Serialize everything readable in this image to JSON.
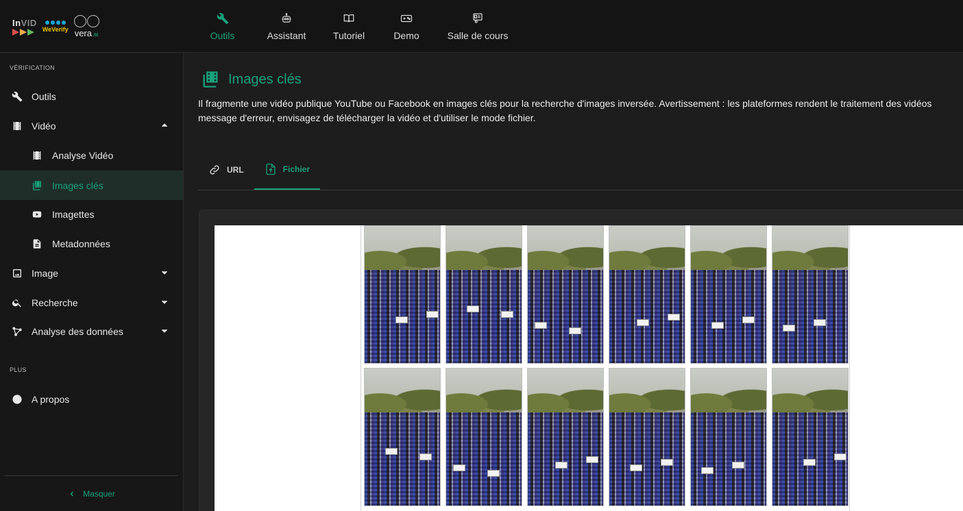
{
  "app": {
    "logos": {
      "invid_a": "In",
      "invid_b": "VID",
      "weverify": "WeVerify",
      "vera": "vera",
      "vera_sub": ".ai"
    }
  },
  "topnav": [
    {
      "label": "Outils",
      "icon": "wrench-icon",
      "active": true
    },
    {
      "label": "Assistant",
      "icon": "robot-icon",
      "active": false
    },
    {
      "label": "Tutoriel",
      "icon": "book-icon",
      "active": false
    },
    {
      "label": "Demo",
      "icon": "gamepad-icon",
      "active": false
    },
    {
      "label": "Salle de cours",
      "icon": "classroom-icon",
      "active": false
    }
  ],
  "sidebar": {
    "section_verification": "VÉRIFICATION",
    "section_plus": "PLUS",
    "items": [
      {
        "label": "Outils",
        "icon": "wrench-icon"
      },
      {
        "label": "Vidéo",
        "icon": "film-icon",
        "expanded": true
      },
      {
        "label": "Analyse Vidéo",
        "icon": "film-icon"
      },
      {
        "label": "Images clés",
        "icon": "keyframes-icon",
        "active": true
      },
      {
        "label": "Imagettes",
        "icon": "youtube-icon"
      },
      {
        "label": "Metadonnées",
        "icon": "document-icon"
      },
      {
        "label": "Image",
        "icon": "image-icon",
        "expanded": false
      },
      {
        "label": "Recherche",
        "icon": "search-icon",
        "expanded": false
      },
      {
        "label": "Analyse des données",
        "icon": "graph-icon",
        "expanded": false
      },
      {
        "label": "A propos",
        "icon": "info-icon"
      }
    ],
    "collapse_label": "Masquer"
  },
  "main": {
    "title": "Images clés",
    "description_line1": "Il fragmente une vidéo publique YouTube ou Facebook en images clés pour la recherche d'images inversée. Avertissement : les plateformes rendent le traitement des vidéos",
    "description_line2": "message d'erreur, envisagez de télécharger la vidéo et d'utiliser le mode fichier.",
    "tabs": [
      {
        "label": "URL",
        "icon": "link-icon",
        "active": false
      },
      {
        "label": "Fichier",
        "icon": "file-upload-icon",
        "active": true
      }
    ],
    "frames_count": 12
  },
  "colors": {
    "accent": "#18a17a",
    "bg": "#1d1d1d",
    "sidebar_bg": "#171717",
    "topbar_bg": "#141414"
  }
}
